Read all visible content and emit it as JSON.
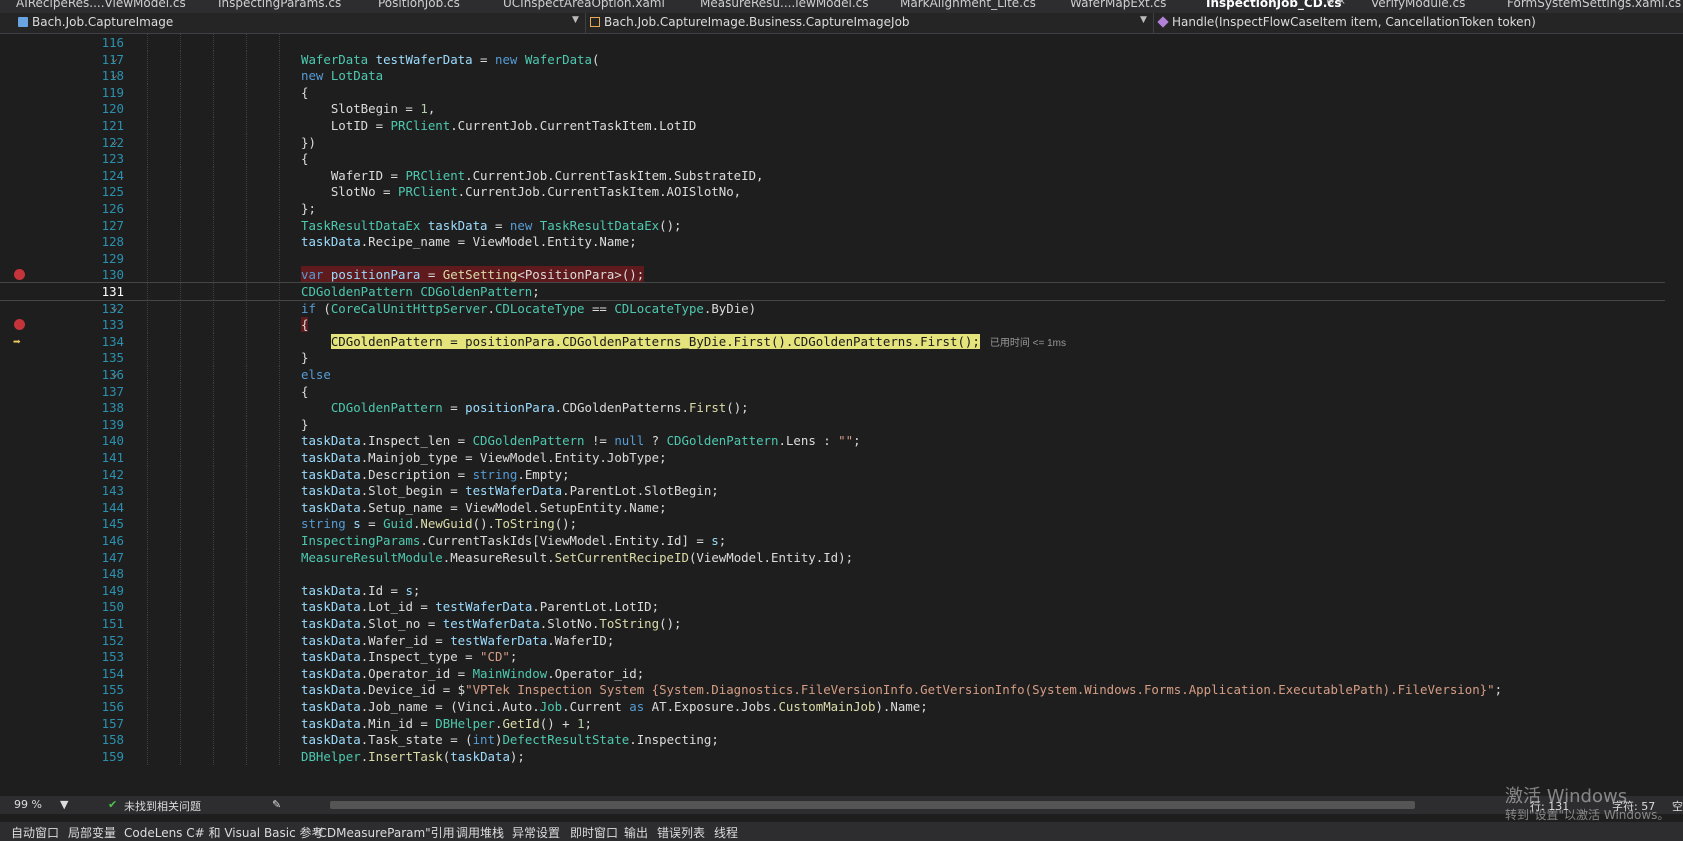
{
  "tabs": [
    {
      "label": "AIRecipeRes....ViewModel.cs"
    },
    {
      "label": "InspectingParams.cs"
    },
    {
      "label": "PositionJob.cs"
    },
    {
      "label": "UCInspectAreaOption.xaml"
    },
    {
      "label": "MeasureResu....iewModel.cs"
    },
    {
      "label": "MarkAlignment_Lite.cs"
    },
    {
      "label": "WaferMapExt.cs"
    },
    {
      "label": "InspectionJob_CD.cs"
    },
    {
      "label": "VerifyModule.cs"
    },
    {
      "label": "FormSystemSettings.xaml.cs"
    }
  ],
  "navbar": {
    "project": "Bach.Job.CaptureImage",
    "class": "Bach.Job.CaptureImage.Business.CaptureImageJob",
    "member": "Handle(InspectFlowCaseItem item, CancellationToken token)"
  },
  "editor": {
    "elapsed": "已用时间 <= 1ms",
    "lines": [
      {
        "n": "116",
        "text": ""
      },
      {
        "n": "117",
        "text": "WaferData testWaferData = new WaferData("
      },
      {
        "n": "118",
        "text": "new LotData"
      },
      {
        "n": "119",
        "text": "{"
      },
      {
        "n": "120",
        "text": "    SlotBegin = 1,"
      },
      {
        "n": "121",
        "text": "    LotID = PRClient.CurrentJob.CurrentTaskItem.LotID"
      },
      {
        "n": "122",
        "text": "})"
      },
      {
        "n": "123",
        "text": "{"
      },
      {
        "n": "124",
        "text": "    WaferID = PRClient.CurrentJob.CurrentTaskItem.SubstrateID,"
      },
      {
        "n": "125",
        "text": "    SlotNo = PRClient.CurrentJob.CurrentTaskItem.AOISlotNo,"
      },
      {
        "n": "126",
        "text": "};"
      },
      {
        "n": "127",
        "text": "TaskResultDataEx taskData = new TaskResultDataEx();"
      },
      {
        "n": "128",
        "text": "taskData.Recipe_name = ViewModel.Entity.Name;"
      },
      {
        "n": "129",
        "text": ""
      },
      {
        "n": "130",
        "text": "var positionPara = GetSetting<PositionPara>();"
      },
      {
        "n": "131",
        "text": "CDGoldenPattern CDGoldenPattern;"
      },
      {
        "n": "132",
        "text": "if (CoreCalUnitHttpServer.CDLocateType == CDLocateType.ByDie)"
      },
      {
        "n": "133",
        "text": "{"
      },
      {
        "n": "134",
        "text": "    CDGoldenPattern = positionPara.CDGoldenPatterns_ByDie.First().CDGoldenPatterns.First();"
      },
      {
        "n": "135",
        "text": "}"
      },
      {
        "n": "136",
        "text": "else"
      },
      {
        "n": "137",
        "text": "{"
      },
      {
        "n": "138",
        "text": "    CDGoldenPattern = positionPara.CDGoldenPatterns.First();"
      },
      {
        "n": "139",
        "text": "}"
      },
      {
        "n": "140",
        "text": "taskData.Inspect_len = CDGoldenPattern != null ? CDGoldenPattern.Lens : \"\";"
      },
      {
        "n": "141",
        "text": "taskData.Mainjob_type = ViewModel.Entity.JobType;"
      },
      {
        "n": "142",
        "text": "taskData.Description = string.Empty;"
      },
      {
        "n": "143",
        "text": "taskData.Slot_begin = testWaferData.ParentLot.SlotBegin;"
      },
      {
        "n": "144",
        "text": "taskData.Setup_name = ViewModel.SetupEntity.Name;"
      },
      {
        "n": "145",
        "text": "string s = Guid.NewGuid().ToString();"
      },
      {
        "n": "146",
        "text": "InspectingParams.CurrentTaskIds[ViewModel.Entity.Id] = s;"
      },
      {
        "n": "147",
        "text": "MeasureResultModule.MeasureResult.SetCurrentRecipeID(ViewModel.Entity.Id);"
      },
      {
        "n": "148",
        "text": ""
      },
      {
        "n": "149",
        "text": "taskData.Id = s;"
      },
      {
        "n": "150",
        "text": "taskData.Lot_id = testWaferData.ParentLot.LotID;"
      },
      {
        "n": "151",
        "text": "taskData.Slot_no = testWaferData.SlotNo.ToString();"
      },
      {
        "n": "152",
        "text": "taskData.Wafer_id = testWaferData.WaferID;"
      },
      {
        "n": "153",
        "text": "taskData.Inspect_type = \"CD\";"
      },
      {
        "n": "154",
        "text": "taskData.Operator_id = MainWindow.Operator_id;"
      },
      {
        "n": "155",
        "text": "taskData.Device_id = $\"VPTek Inspection System {System.Diagnostics.FileVersionInfo.GetVersionInfo(System.Windows.Forms.Application.ExecutablePath).FileVersion}\";"
      },
      {
        "n": "156",
        "text": "taskData.Job_name = (Vinci.Auto.Job.Current as AT.Exposure.Jobs.CustomMainJob).Name;"
      },
      {
        "n": "157",
        "text": "taskData.Min_id = DBHelper.GetId() + 1;"
      },
      {
        "n": "158",
        "text": "taskData.Task_state = (int)DefectResultState.Inspecting;"
      },
      {
        "n": "159",
        "text": "DBHelper.InsertTask(taskData);"
      }
    ]
  },
  "status": {
    "zoom": "99 %",
    "issues": "未找到相关问题",
    "row": "行: 131",
    "col": "字符: 57",
    "space": "空"
  },
  "bottom_tabs": [
    "自动窗口",
    "局部变量",
    "CodeLens C# 和 Visual Basic 参考",
    "\"CDMeasureParam\"引用",
    "调用堆栈",
    "异常设置",
    "即时窗口",
    "输出",
    "错误列表",
    "线程"
  ],
  "watermark": {
    "line1": "激活 Windows",
    "line2": "转到\"设置\"以激活 Windows。"
  }
}
